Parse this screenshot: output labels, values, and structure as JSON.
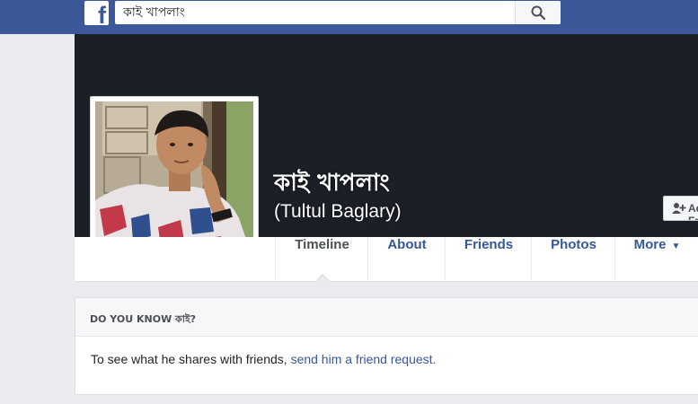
{
  "topbar": {
    "logo_letter": "f",
    "search": {
      "value": "কাই খাপলাং",
      "placeholder": "Search"
    }
  },
  "profile": {
    "name": "কাই খাপলাং",
    "alternate_name": "(Tultul Baglary)",
    "add_friend_label": "Add Friend"
  },
  "nav": {
    "tabs": [
      {
        "label": "Timeline"
      },
      {
        "label": "About"
      },
      {
        "label": "Friends"
      },
      {
        "label": "Photos"
      },
      {
        "label": "More"
      }
    ],
    "active_tab": "Timeline"
  },
  "know_card": {
    "title": "DO YOU KNOW কাই?",
    "body_text": "To see what he shares with friends, ",
    "link_text": "send him a friend request."
  },
  "colors": {
    "facebook_blue": "#3b5998",
    "link_blue": "#365899",
    "cover_dark": "#1b1f27",
    "page_bg": "#e9ebee"
  }
}
